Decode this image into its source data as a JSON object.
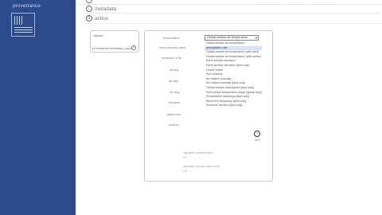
{
  "brand": {
    "name": "provenance"
  },
  "top": {
    "dots": "··· ··· ···"
  },
  "breadcrumbs": [
    {
      "label": "metadata",
      "icon": "back-arrow-icon",
      "glyph": "←"
    },
    {
      "label": "action",
      "icon": "step-icon",
      "glyph": "1"
    }
  ],
  "left_panel": {
    "title": "variant",
    "item": "provenance:metadata_input",
    "icon_glyph": "+"
  },
  "form": {
    "labels": [
      "temperature",
      "lower primary name",
      "resolution & dir",
      "lat deg",
      "lat step",
      "lon deg",
      "filename",
      "depth end",
      "method"
    ],
    "select": {
      "value": "Global surface air temperature",
      "caret": "▾",
      "options": [
        "Global surface air temperature",
        "precipitation rate",
        "Global surface air temperature (with land)",
        "Global surface air temperature (with ocean)",
        "Earth surface elevation",
        "Earth surface elevation (land only)",
        "Ocean Depth",
        "Soil moisture",
        "Air relative humidity",
        "Air relative humidity (land only)",
        "Global surface wind speed (land only)",
        "Sea surface temperature stage (global only)",
        "Precipitation frequency (land only)",
        "Wind field frequency (land only)",
        "Sunshine fraction (land only)"
      ],
      "selected_index": 1
    },
    "next": {
      "glyph": "›",
      "label": "next"
    },
    "notes": [
      "calculated channel output",
      "0.5",
      "calculated channel output name",
      "0.5"
    ]
  }
}
